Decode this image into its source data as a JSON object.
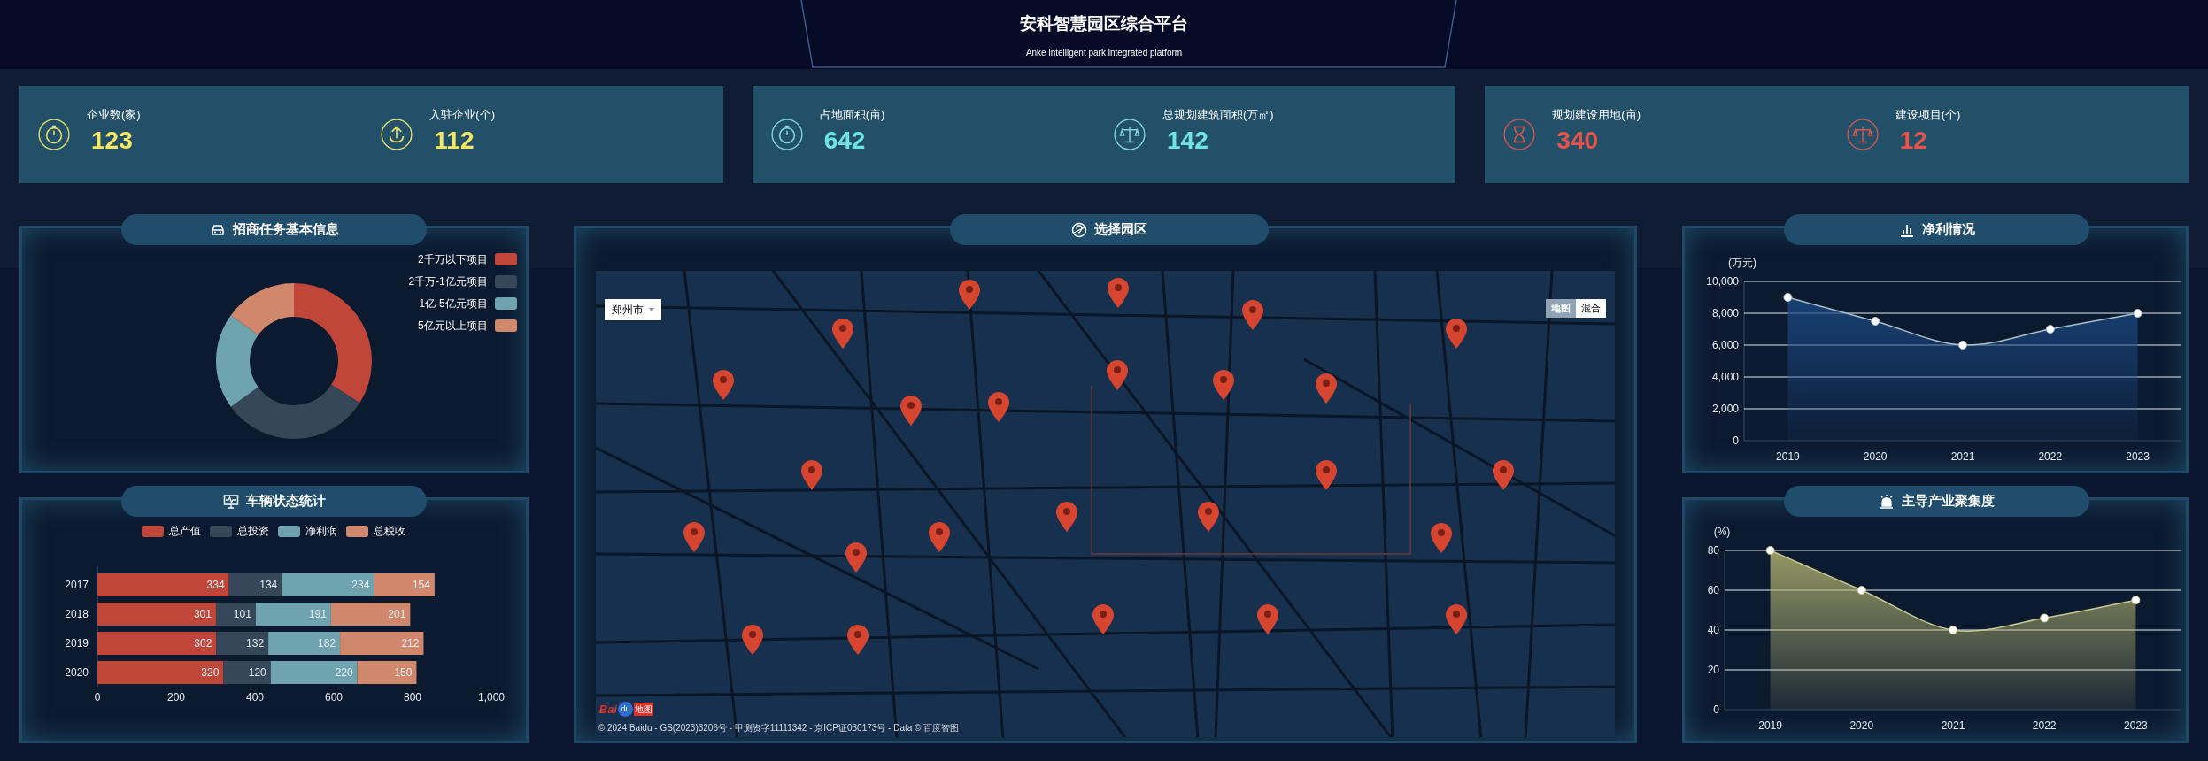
{
  "header": {
    "title": "安科智慧园区综合平台",
    "subtitle": "Anke intelligent park integrated platform"
  },
  "stats": [
    {
      "label": "企业数(家)",
      "value": "123",
      "kind": "timer",
      "color": "#f5e663"
    },
    {
      "label": "入驻企业(个)",
      "value": "112",
      "kind": "upload",
      "color": "#f5e663"
    },
    {
      "label": "占地面积(亩)",
      "value": "642",
      "kind": "timer",
      "color": "#6fe3e6"
    },
    {
      "label": "总规划建筑面积(万㎡)",
      "value": "142",
      "kind": "scale",
      "color": "#6fe3e6"
    },
    {
      "label": "规划建设用地(亩)",
      "value": "340",
      "kind": "hourglass",
      "color": "#e8534a"
    },
    {
      "label": "建设项目(个)",
      "value": "12",
      "kind": "scale",
      "color": "#e8534a"
    }
  ],
  "investment_panel": {
    "title": "招商任务基本信息",
    "legend": [
      {
        "label": "2千万以下项目",
        "color": "#c0463a"
      },
      {
        "label": "2千万-1亿元项目",
        "color": "#37475a"
      },
      {
        "label": "1亿-5亿元项目",
        "color": "#6fa3ad"
      },
      {
        "label": "5亿元以上项目",
        "color": "#d1876b"
      }
    ]
  },
  "vehicle_panel": {
    "title": "车辆状态统计",
    "chart_data": {
      "type": "bar",
      "orientation": "horizontal",
      "stacked": true,
      "data_labels": true,
      "categories": [
        "2017",
        "2018",
        "2019",
        "2020"
      ],
      "xlim": [
        0,
        1000
      ],
      "xticks": [
        0,
        200,
        400,
        600,
        800,
        {
          "value": 1000,
          "label": "1,000"
        }
      ],
      "series": [
        {
          "name": "总产值",
          "color": "#c0463a",
          "values": [
            334,
            301,
            302,
            320
          ]
        },
        {
          "name": "总投资",
          "color": "#37475a",
          "values": [
            134,
            101,
            132,
            120
          ]
        },
        {
          "name": "净利润",
          "color": "#6fa3ad",
          "values": [
            234,
            191,
            182,
            220
          ]
        },
        {
          "name": "总税收",
          "color": "#d1876b",
          "values": [
            154,
            201,
            212,
            150
          ]
        }
      ]
    }
  },
  "map_panel": {
    "title": "选择园区",
    "city_select": "郑州市",
    "map_types": [
      {
        "label": "地图",
        "selected": true
      },
      {
        "label": "混合",
        "selected": false
      }
    ],
    "logo": {
      "text": "Bai",
      "badge": "du",
      "suffix": "地图"
    },
    "copyright": "© 2024 Baidu - GS(2023)3206号 - 甲测资字11111342 - 京ICP证030173号 - Data © 百度智图"
  },
  "profit_panel": {
    "title": "净利情况",
    "chart_data": {
      "type": "area",
      "ylabel": "(万元)",
      "grid": true,
      "categories": [
        "2019",
        "2020",
        "2021",
        "2022",
        "2023"
      ],
      "ylim": [
        0,
        10000
      ],
      "yticks": [
        0,
        {
          "value": 2000,
          "label": "2,000"
        },
        {
          "value": 4000,
          "label": "4,000"
        },
        {
          "value": 6000,
          "label": "6,000"
        },
        {
          "value": 8000,
          "label": "8,000"
        },
        {
          "value": 10000,
          "label": "10,000"
        }
      ],
      "series": [
        {
          "color": "#a9c0c9",
          "values": [
            9000,
            7500,
            6000,
            7000,
            8000
          ]
        }
      ]
    }
  },
  "cluster_panel": {
    "title": "主导产业聚集度",
    "chart_data": {
      "type": "area",
      "ylabel": "(%)",
      "grid": true,
      "categories": [
        "2019",
        "2020",
        "2021",
        "2022",
        "2023"
      ],
      "ylim": [
        0,
        80
      ],
      "yticks": [
        0,
        20,
        40,
        60,
        80
      ],
      "series": [
        {
          "color": "#c9c98f",
          "values": [
            80,
            60,
            40,
            46,
            55
          ]
        }
      ]
    }
  }
}
